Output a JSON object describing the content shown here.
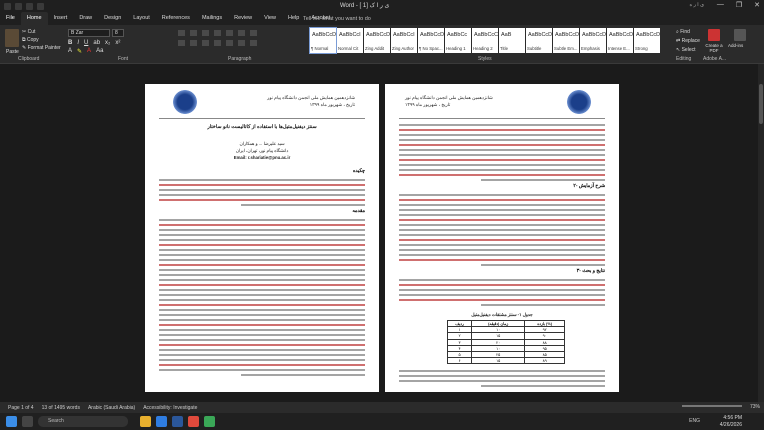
{
  "window": {
    "title": "Word - [ 1] ی ر ا ک",
    "user": "ی ا ر ه",
    "controls": [
      "—",
      "❐",
      "✕"
    ]
  },
  "ribbon_tabs": [
    "File",
    "Home",
    "Insert",
    "Draw",
    "Design",
    "Layout",
    "References",
    "Mailings",
    "Review",
    "View",
    "Help",
    "Acrobat"
  ],
  "tell_me": "Tell me what you want to do",
  "clipboard": {
    "paste": "Paste",
    "cut": "Cut",
    "copy": "Copy",
    "format_painter": "Format Painter",
    "label": "Clipboard"
  },
  "font": {
    "name": "B Zar",
    "size": "8",
    "label": "Font"
  },
  "paragraph_label": "Paragraph",
  "styles": {
    "label": "Styles",
    "items": [
      {
        "sample": "AaBbCcDc",
        "name": "¶ Normal"
      },
      {
        "sample": "AaBbCcI",
        "name": "Normal Cit"
      },
      {
        "sample": "AaBbCcDd",
        "name": "Zing Addit"
      },
      {
        "sample": "AaBbCcI",
        "name": "Zing Author"
      },
      {
        "sample": "AaBbCcDc",
        "name": "¶ No Spac..."
      },
      {
        "sample": "AaBbCc",
        "name": "Heading 1"
      },
      {
        "sample": "AaBbCcC",
        "name": "Heading 2"
      },
      {
        "sample": "AaB",
        "name": "Title"
      },
      {
        "sample": "AaBbCcD",
        "name": "Subtitle"
      },
      {
        "sample": "AaBbCcDa",
        "name": "Subtle Em..."
      },
      {
        "sample": "AaBbCcDa",
        "name": "Emphasis"
      },
      {
        "sample": "AaBbCcDa",
        "name": "Intense E..."
      },
      {
        "sample": "AaBbCcDa",
        "name": "Strong"
      }
    ]
  },
  "editing": {
    "find": "Find",
    "replace": "Replace",
    "select": "Select",
    "label": "Editing"
  },
  "acrobat": {
    "create_pdf": "Create a PDF",
    "group": "Adobe A..."
  },
  "addins": {
    "label": "Add-ins"
  },
  "page_left": {
    "header_line1": "شانزدهمین همایش ملی انجمن دانشگاه پیام نور",
    "header_line2": "تاریخ ، شهریور ماه ۱۳۹۹",
    "title": "سنتز دیفنیل‌متیل‌ها با استفاده از کاتالیست نانو ساختار",
    "authors": "سید علیرضا ... و همکاران",
    "affiliation": "دانشگاه پیام نور، تهران، ایران",
    "email": "Email: r.shariatie@pnu.ac.ir",
    "abstract_h": "چکیده",
    "intro_h": "مقدمه"
  },
  "page_right": {
    "header_line1": "شانزدهمین همایش ملی انجمن دانشگاه پیام نور",
    "header_line2": "تاریخ ، شهریور ماه ۱۳۹۹",
    "method_h": "۲- شرح آزمایش",
    "results_h": "۳- نتایج و بحث",
    "table_caption": "جدول ۱- سنتز مشتقات دیفنیل‌متیل",
    "table": {
      "headers": [
        "ردیف",
        "زمان (دقیقه)",
        "بازده (%)"
      ],
      "rows": [
        [
          "۱",
          "۱۰",
          "۹۲"
        ],
        [
          "۲",
          "۱۵",
          "۹۰"
        ],
        [
          "۳",
          "۲۰",
          "۸۸"
        ],
        [
          "۴",
          "۱۰",
          "۹۵"
        ],
        [
          "۵",
          "۲۵",
          "۸۵"
        ],
        [
          "۶",
          "۱۵",
          "۸۹"
        ]
      ]
    }
  },
  "status": {
    "page": "Page 1 of 4",
    "words": "13 of 1495 words",
    "language": "Arabic (Saudi Arabia)",
    "accessibility": "Accessibility: Investigate",
    "zoom": "73%"
  },
  "taskbar": {
    "search": "Search",
    "time": "4:56 PM",
    "date": "4/26/2026",
    "lang": "ENG"
  }
}
